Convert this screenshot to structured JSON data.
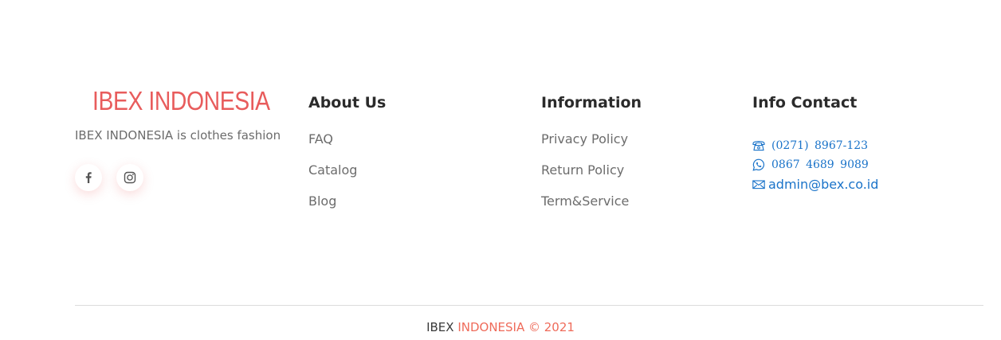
{
  "brand": {
    "name": "IBEX INDONESIA",
    "tagline": "IBEX INDONESIA is clothes fashion",
    "accent_color": "#e85c5c"
  },
  "social": [
    {
      "name": "facebook",
      "icon": "facebook-icon"
    },
    {
      "name": "instagram",
      "icon": "instagram-icon"
    }
  ],
  "about": {
    "title": "About Us",
    "links": [
      "FAQ",
      "Catalog",
      "Blog"
    ]
  },
  "information": {
    "title": "Information",
    "links": [
      "Privacy Policy",
      "Return Policy",
      "Term&Service"
    ]
  },
  "contact": {
    "title": "Info Contact",
    "phone": "(0271) 8967-123",
    "whatsapp": "0867 4689 9089",
    "email": "admin@bex.co.id",
    "link_color": "#1a73c9"
  },
  "footer": {
    "copyright_part1": "IBEX ",
    "copyright_part2": "INDONESIA © 2021"
  }
}
